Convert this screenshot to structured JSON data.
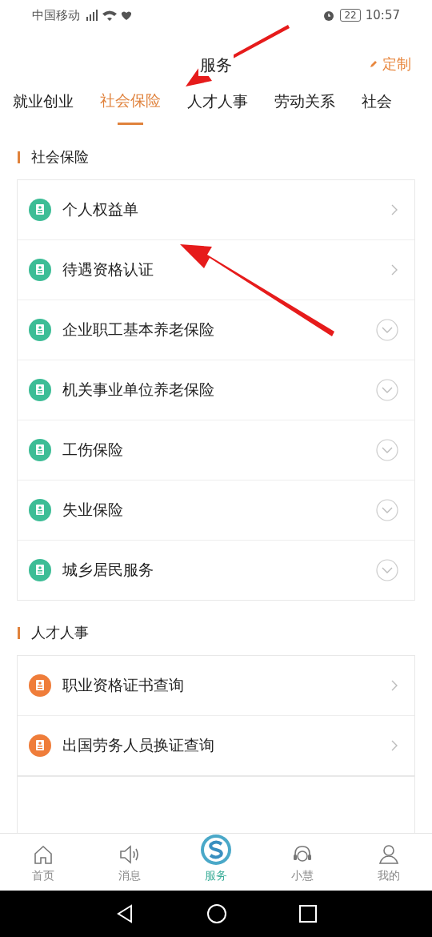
{
  "status_bar": {
    "carrier": "中国移动",
    "battery": "22",
    "time": "10:57"
  },
  "header": {
    "title": "服务",
    "action": "定制"
  },
  "tabs": [
    {
      "label": "就业创业",
      "selected": false
    },
    {
      "label": "社会保险",
      "selected": true
    },
    {
      "label": "人才人事",
      "selected": false
    },
    {
      "label": "劳动关系",
      "selected": false
    },
    {
      "label": "社会",
      "selected": false
    }
  ],
  "sections": [
    {
      "title": "社会保险",
      "color": "#3dbd96",
      "items": [
        {
          "label": "个人权益单",
          "kind": "link"
        },
        {
          "label": "待遇资格认证",
          "kind": "link"
        },
        {
          "label": "企业职工基本养老保险",
          "kind": "expand"
        },
        {
          "label": "机关事业单位养老保险",
          "kind": "expand"
        },
        {
          "label": "工伤保险",
          "kind": "expand"
        },
        {
          "label": "失业保险",
          "kind": "expand"
        },
        {
          "label": "城乡居民服务",
          "kind": "expand"
        }
      ]
    },
    {
      "title": "人才人事",
      "color": "#ef7d3a",
      "items": [
        {
          "label": "职业资格证书查询",
          "kind": "link"
        },
        {
          "label": "出国劳务人员换证查询",
          "kind": "link"
        }
      ]
    }
  ],
  "bottom_nav": [
    {
      "label": "首页",
      "kind": "home",
      "selected": false
    },
    {
      "label": "消息",
      "kind": "speaker",
      "selected": false
    },
    {
      "label": "服务",
      "kind": "logo",
      "selected": true
    },
    {
      "label": "小慧",
      "kind": "headset",
      "selected": false
    },
    {
      "label": "我的",
      "kind": "person",
      "selected": false
    }
  ]
}
